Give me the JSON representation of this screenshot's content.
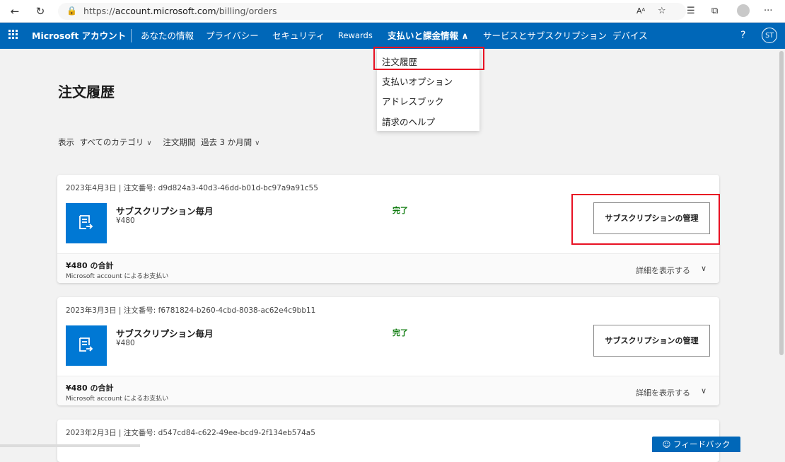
{
  "browser": {
    "url_prefix": "https://",
    "url_host": "account.microsoft.com",
    "url_path": "/billing/orders",
    "read_aloud_label": "Aᴬ"
  },
  "header": {
    "brand": "Microsoft アカウント",
    "nav": [
      {
        "label": "あなたの情報"
      },
      {
        "label": "プライバシー"
      },
      {
        "label": "セキュリティ"
      },
      {
        "label": "Rewards"
      },
      {
        "label": "支払いと課金情報 ∧"
      },
      {
        "label": "サービスとサブスクリプション"
      },
      {
        "label": "デバイス"
      }
    ],
    "help": "?",
    "avatar_initials": "ST"
  },
  "dropdown": {
    "items": [
      {
        "label": "注文履歴"
      },
      {
        "label": "支払いオプション"
      },
      {
        "label": "アドレスブック"
      },
      {
        "label": "請求のヘルプ"
      }
    ]
  },
  "page": {
    "title": "注文履歴",
    "filter_show_label": "表示",
    "filter_category": "すべてのカテゴリ",
    "filter_period_label": "注文期間",
    "filter_period": "過去 3 か月間"
  },
  "orders": [
    {
      "meta": "2023年4月3日 | 注文番号: d9d824a3-40d3-46dd-b01d-bc97a9a91c55",
      "product": "サブスクリプション毎月",
      "price": "¥480",
      "status": "完了",
      "manage": "サブスクリプションの管理",
      "total": "¥480 の合計",
      "paid_by": "Microsoft account によるお支払い",
      "details": "詳細を表示する"
    },
    {
      "meta": "2023年3月3日 | 注文番号: f6781824-b260-4cbd-8038-ac62e4c9bb11",
      "product": "サブスクリプション毎月",
      "price": "¥480",
      "status": "完了",
      "manage": "サブスクリプションの管理",
      "total": "¥480 の合計",
      "paid_by": "Microsoft account によるお支払い",
      "details": "詳細を表示する"
    },
    {
      "meta": "2023年2月3日 | 注文番号: d547cd84-c622-49ee-bcd9-2f134eb574a5"
    }
  ],
  "feedback": "☺ フィードバック",
  "colors": {
    "brand_blue": "#0067b8",
    "tile_blue": "#0078d4",
    "status_green": "#107c10",
    "highlight_red": "#e81123"
  }
}
